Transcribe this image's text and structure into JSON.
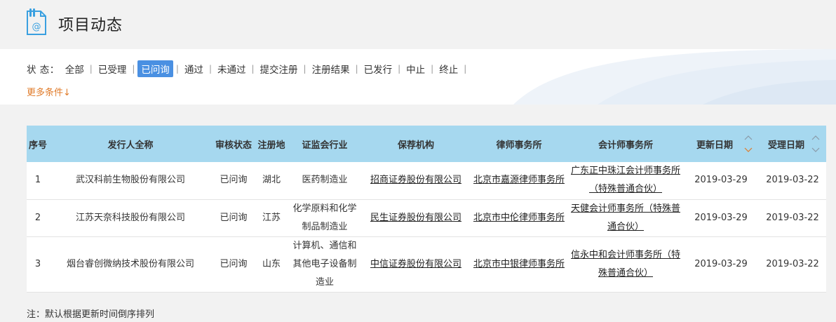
{
  "header": {
    "title": "项目动态",
    "icon": "document-at-icon"
  },
  "filters": {
    "status_label": "状  态：",
    "status_items": [
      "全部",
      "已受理",
      "已问询",
      "通过",
      "未通过",
      "提交注册",
      "注册结果",
      "已发行",
      "中止",
      "终止"
    ],
    "active_index": 2,
    "more_label": "更多条件↓"
  },
  "table": {
    "headers": [
      "序号",
      "发行人全称",
      "审核状态",
      "注册地",
      "证监会行业",
      "保荐机构",
      "律师事务所",
      "会计师事务所",
      "更新日期",
      "受理日期"
    ],
    "sortable": [
      "更新日期",
      "受理日期"
    ],
    "rows": [
      {
        "no": "1",
        "issuer": "武汉科前生物股份有限公司",
        "status": "已问询",
        "region": "湖北",
        "industry": "医药制造业",
        "sponsor": "招商证券股份有限公司",
        "law": "北京市嘉源律师事务所",
        "accounting": "广东正中珠江会计师事务所（特殊普通合伙）",
        "updated": "2019-03-29",
        "accepted": "2019-03-22"
      },
      {
        "no": "2",
        "issuer": "江苏天奈科技股份有限公司",
        "status": "已问询",
        "region": "江苏",
        "industry": "化学原料和化学制品制造业",
        "sponsor": "民生证券股份有限公司",
        "law": "北京市中伦律师事务所",
        "accounting": "天健会计师事务所（特殊普通合伙）",
        "updated": "2019-03-29",
        "accepted": "2019-03-22"
      },
      {
        "no": "3",
        "issuer": "烟台睿创微纳技术股份有限公司",
        "status": "已问询",
        "region": "山东",
        "industry": "计算机、通信和其他电子设备制造业",
        "sponsor": "中信证券股份有限公司",
        "law": "北京市中银律师事务所",
        "accounting": "信永中和会计师事务所（特殊普通合伙）",
        "updated": "2019-03-29",
        "accepted": "2019-03-22"
      }
    ]
  },
  "note": "注：默认根据更新时间倒序排列",
  "colors": {
    "header_bg": "#a6d8ef",
    "active_filter": "#4a90e2",
    "more_link": "#e07b2a",
    "icon": "#3aa0e0"
  }
}
